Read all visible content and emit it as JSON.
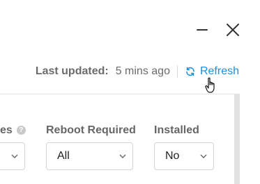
{
  "window": {
    "minimize_icon": "minimize-icon",
    "close_icon": "close-icon"
  },
  "status": {
    "label": "Last updated:",
    "value": "5 mins ago",
    "refresh_label": "Refresh",
    "accent": "#1a8fe0"
  },
  "filters": [
    {
      "label": "es",
      "value": "",
      "has_help": true
    },
    {
      "label": "Reboot Required",
      "value": "All"
    },
    {
      "label": "Installed",
      "value": "No"
    }
  ]
}
